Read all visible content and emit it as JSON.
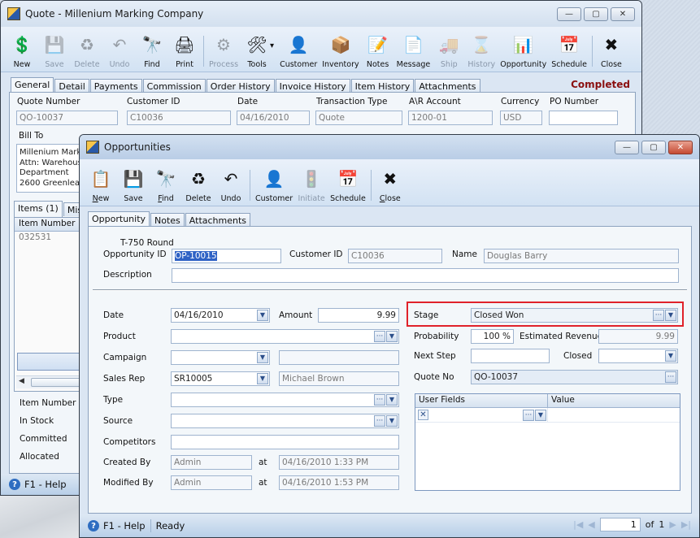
{
  "quote_window": {
    "title": "Quote - Millenium Marking Company",
    "window_controls": {
      "minimize": "—",
      "maximize": "▢",
      "close": "✕"
    },
    "toolbar": [
      {
        "label": "New",
        "icon": "new-icon",
        "glyph": "💲",
        "enabled": true
      },
      {
        "label": "Save",
        "icon": "save-icon",
        "glyph": "💾",
        "enabled": false
      },
      {
        "label": "Delete",
        "icon": "delete-icon",
        "glyph": "♻",
        "enabled": false
      },
      {
        "label": "Undo",
        "icon": "undo-icon",
        "glyph": "↶",
        "enabled": false
      },
      {
        "label": "Find",
        "icon": "find-icon",
        "glyph": "🔭",
        "enabled": true
      },
      {
        "label": "Print",
        "icon": "print-icon",
        "glyph": "🖨",
        "enabled": true
      },
      {
        "label": "Process",
        "icon": "process-icon",
        "glyph": "⚙",
        "enabled": false
      },
      {
        "label": "Tools",
        "icon": "tools-icon",
        "glyph": "🛠",
        "enabled": true
      },
      {
        "label": "Customer",
        "icon": "customer-icon",
        "glyph": "👤",
        "enabled": true
      },
      {
        "label": "Inventory",
        "icon": "inventory-icon",
        "glyph": "📦",
        "enabled": true
      },
      {
        "label": "Notes",
        "icon": "notes-icon",
        "glyph": "📝",
        "enabled": true
      },
      {
        "label": "Message",
        "icon": "message-icon",
        "glyph": "📄",
        "enabled": true
      },
      {
        "label": "Ship",
        "icon": "ship-icon",
        "glyph": "🚚",
        "enabled": false
      },
      {
        "label": "History",
        "icon": "history-icon",
        "glyph": "⌛",
        "enabled": false
      },
      {
        "label": "Opportunity",
        "icon": "opportunity-icon",
        "glyph": "📊",
        "enabled": true
      },
      {
        "label": "Schedule",
        "icon": "schedule-icon",
        "glyph": "📅",
        "enabled": true
      },
      {
        "label": "Close",
        "icon": "close-icon",
        "glyph": "✖",
        "enabled": true
      }
    ],
    "tabs": [
      "General",
      "Detail",
      "Payments",
      "Commission",
      "Order History",
      "Invoice History",
      "Item History",
      "Attachments"
    ],
    "active_tab": "General",
    "status": "Completed",
    "status_color": "#8a0f0f",
    "fields": {
      "quote_number": {
        "label": "Quote Number",
        "value": "QO-10037"
      },
      "customer_id": {
        "label": "Customer ID",
        "value": "C10036"
      },
      "date": {
        "label": "Date",
        "value": "04/16/2010"
      },
      "transaction_type": {
        "label": "Transaction Type",
        "value": "Quote"
      },
      "ar_account": {
        "label": "A\\R Account",
        "value": "1200-01"
      },
      "currency": {
        "label": "Currency",
        "value": "USD"
      },
      "po_number": {
        "label": "PO Number",
        "value": ""
      }
    },
    "bill_to": {
      "label": "Bill To",
      "lines": [
        "Millenium Marki",
        "Attn: Warehous",
        "Department",
        "2600 Greenlea"
      ]
    },
    "item_tabs": [
      "Items (1)",
      "Misc"
    ],
    "items_grid": {
      "header": "Item Number",
      "rows": [
        "032531"
      ]
    },
    "item_detail_labels": [
      "Item Number",
      "In Stock",
      "Committed",
      "Allocated"
    ],
    "statusbar": {
      "help": "F1 - Help"
    }
  },
  "opp_window": {
    "title": "Opportunities",
    "window_controls": {
      "minimize": "—",
      "maximize": "▢",
      "close": "✕"
    },
    "toolbar": [
      {
        "label": "New",
        "u": "N",
        "rest": "ew",
        "icon": "new-icon",
        "glyph": "📋",
        "enabled": true
      },
      {
        "label": "Save",
        "u": "",
        "rest": "Save",
        "icon": "save-icon",
        "glyph": "💾",
        "enabled": true
      },
      {
        "label": "Find",
        "u": "F",
        "rest": "ind",
        "icon": "find-icon",
        "glyph": "🔭",
        "enabled": true
      },
      {
        "label": "Delete",
        "u": "",
        "rest": "Delete",
        "icon": "delete-icon",
        "glyph": "♻",
        "enabled": true
      },
      {
        "label": "Undo",
        "u": "",
        "rest": "Undo",
        "icon": "undo-icon",
        "glyph": "↶",
        "enabled": true
      },
      {
        "label": "Customer",
        "u": "",
        "rest": "Customer",
        "icon": "customer-icon",
        "glyph": "👤",
        "enabled": true
      },
      {
        "label": "Initiate",
        "u": "",
        "rest": "Initiate",
        "icon": "initiate-icon",
        "glyph": "🚦",
        "enabled": false
      },
      {
        "label": "Schedule",
        "u": "",
        "rest": "Schedule",
        "icon": "schedule-icon",
        "glyph": "📅",
        "enabled": true
      },
      {
        "label": "Close",
        "u": "C",
        "rest": "lose",
        "icon": "close-icon",
        "glyph": "✖",
        "enabled": true
      }
    ],
    "tabs": [
      "Opportunity",
      "Notes",
      "Attachments"
    ],
    "active_tab": "Opportunity",
    "header_note": "T-750 Round",
    "fields": {
      "opportunity_id": {
        "label": "Opportunity ID",
        "value": "OP-10015"
      },
      "customer_id": {
        "label": "Customer ID",
        "value": "C10036"
      },
      "name": {
        "label": "Name",
        "value": "Douglas  Barry"
      },
      "description": {
        "label": "Description",
        "value": ""
      },
      "date": {
        "label": "Date",
        "value": "04/16/2010"
      },
      "amount": {
        "label": "Amount",
        "value": "9.99"
      },
      "product": {
        "label": "Product",
        "value": ""
      },
      "campaign": {
        "label": "Campaign",
        "value": "",
        "name_value": ""
      },
      "sales_rep": {
        "label": "Sales Rep",
        "value": "SR10005",
        "name_value": "Michael  Brown"
      },
      "type": {
        "label": "Type",
        "value": ""
      },
      "source": {
        "label": "Source",
        "value": ""
      },
      "competitors": {
        "label": "Competitors",
        "value": ""
      },
      "created_by": {
        "label": "Created By",
        "value": "Admin",
        "at_label": "at",
        "at_value": "04/16/2010 1:33 PM"
      },
      "modified_by": {
        "label": "Modified By",
        "value": "Admin",
        "at_label": "at",
        "at_value": "04/16/2010 1:53 PM"
      },
      "stage": {
        "label": "Stage",
        "value": "Closed Won"
      },
      "probability": {
        "label": "Probability",
        "value": "100 %"
      },
      "estimated_revenue": {
        "label": "Estimated Revenue",
        "value": "9.99"
      },
      "next_step": {
        "label": "Next Step",
        "value": ""
      },
      "closed": {
        "label": "Closed",
        "value": ""
      },
      "quote_no": {
        "label": "Quote No",
        "value": "QO-10037"
      }
    },
    "user_fields_grid": {
      "columns": [
        "User Fields",
        "Value"
      ],
      "rows": [
        {
          "field": "",
          "value": ""
        }
      ]
    },
    "highlight_color": "#e0222a",
    "statusbar": {
      "help": "F1 - Help",
      "status": "Ready"
    },
    "pager": {
      "current": "1",
      "of_label": "of",
      "total": "1"
    }
  }
}
